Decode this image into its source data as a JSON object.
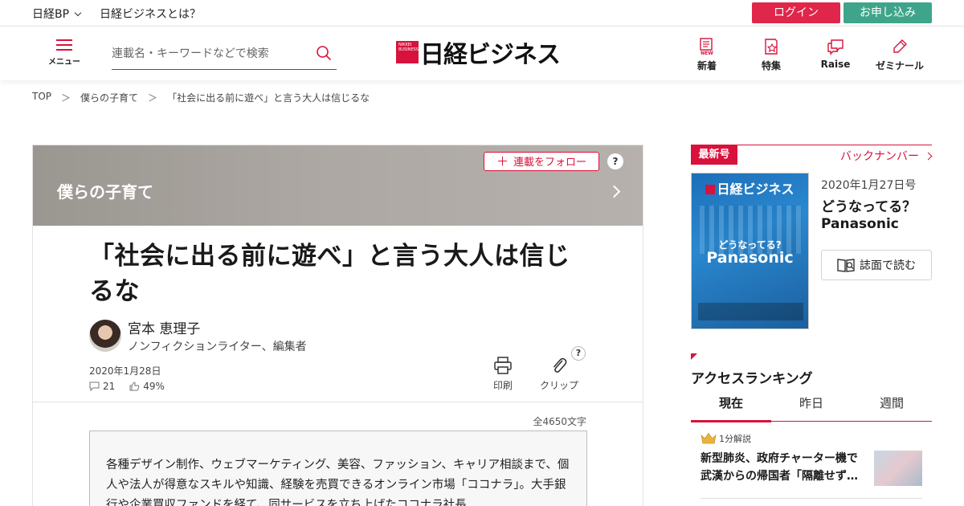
{
  "topbar": {
    "site_menu": "日経BP",
    "about": "日経ビジネスとは？",
    "login": "ログイン",
    "apply": "お申し込み"
  },
  "header": {
    "menu_label": "メニュー",
    "search_placeholder": "連載名・キーワードなどで検索",
    "logo_text": "日経ビジネス",
    "logo_small": "NIKKEI BUSINESS",
    "nav": [
      {
        "label": "新着",
        "icon": "new-icon"
      },
      {
        "label": "特集",
        "icon": "feature-star-icon"
      },
      {
        "label": "Raise",
        "icon": "chat-icon"
      },
      {
        "label": "ゼミナール",
        "icon": "pen-icon"
      }
    ]
  },
  "breadcrumb": {
    "items": [
      "TOP",
      "僕らの子育て",
      "「社会に出る前に遊べ」と言う大人は信じるな"
    ],
    "separator": "＞"
  },
  "article": {
    "series_title": "僕らの子育て",
    "follow_label": "連載をフォロー",
    "help": "?",
    "headline": "「社会に出る前に遊べ」と言う大人は信じるな",
    "author_name": "宮本 恵理子",
    "author_role": "ノンフィクションライター、編集者",
    "date": "2020年1月28日",
    "comments": "21",
    "likes": "49%",
    "print_label": "印刷",
    "clip_label": "クリップ",
    "char_count": "全4650文字",
    "summary": "各種デザイン制作、ウェブマーケティング、美容、ファッション、キャリア相談まで、個人や法人が得意なスキルや知識、経験を売買できるオンライン市場「ココナラ」。大手銀行や企業買収ファンドを経て、同サービスを立ち上げたココナラ社長"
  },
  "sidebar": {
    "latest_tag": "最新号",
    "backnumber": "バックナンバー",
    "cover": {
      "logo": "日経ビジネス",
      "question": "どうなってる?",
      "brand": "Panasonic"
    },
    "issue_date": "2020年1月27日号",
    "issue_title_line1": "どうなってる？",
    "issue_title_line2": "Panasonic",
    "read_button": "誌面で読む",
    "ranking_title": "アクセスランキング",
    "ranking_tabs": [
      "現在",
      "昨日",
      "週間"
    ],
    "ranking_item": {
      "badge": "1分解説",
      "title": "新型肺炎、政府チャーター機で武漢からの帰国者「隔離せず…"
    }
  },
  "colors": {
    "brand_red": "#d8123c",
    "login": "#e0264a",
    "apply": "#3fa58a"
  }
}
